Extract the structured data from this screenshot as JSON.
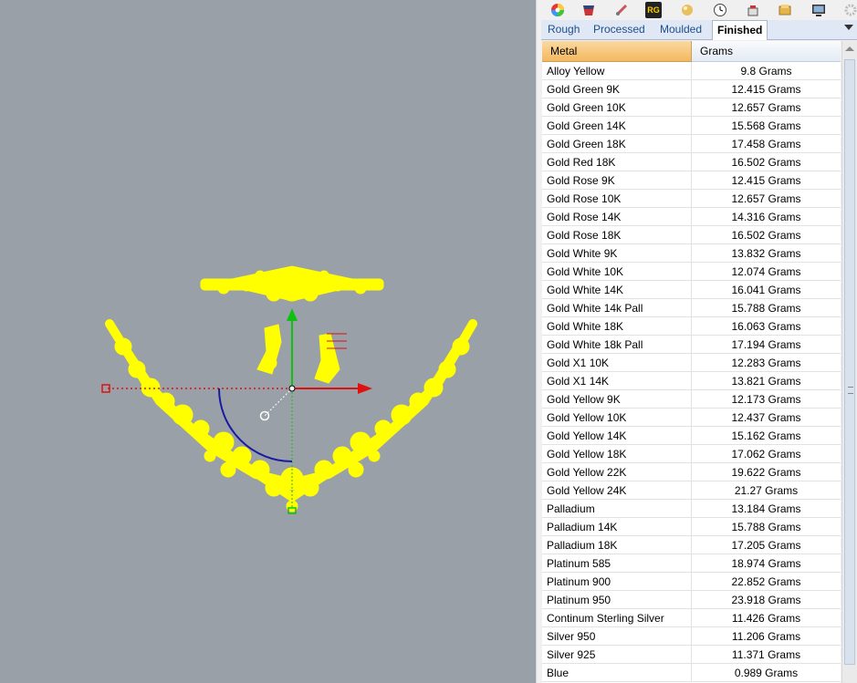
{
  "toolbar": {
    "icons": [
      "color-wheel-icon",
      "paint-bucket-icon",
      "brush-icon",
      "rg-logo-icon",
      "gem-icon",
      "clock-icon",
      "scale-icon",
      "gold-bar-icon",
      "monitor-icon",
      "settings-icon"
    ],
    "rg_label": "RG"
  },
  "tabs": [
    "Rough",
    "Processed",
    "Moulded",
    "Finished"
  ],
  "active_tab": "Finished",
  "table": {
    "headers": [
      "Metal",
      "Grams"
    ],
    "rows": [
      [
        "Alloy Yellow",
        "9.8 Grams"
      ],
      [
        "Gold Green 9K",
        "12.415 Grams"
      ],
      [
        "Gold Green 10K",
        "12.657 Grams"
      ],
      [
        "Gold Green 14K",
        "15.568 Grams"
      ],
      [
        "Gold Green 18K",
        "17.458 Grams"
      ],
      [
        "Gold Red 18K",
        "16.502 Grams"
      ],
      [
        "Gold Rose 9K",
        "12.415 Grams"
      ],
      [
        "Gold Rose 10K",
        "12.657 Grams"
      ],
      [
        "Gold Rose 14K",
        "14.316 Grams"
      ],
      [
        "Gold Rose 18K",
        "16.502 Grams"
      ],
      [
        "Gold White 9K",
        "13.832 Grams"
      ],
      [
        "Gold White 10K",
        "12.074 Grams"
      ],
      [
        "Gold White 14K",
        "16.041 Grams"
      ],
      [
        "Gold White 14k Pall",
        "15.788 Grams"
      ],
      [
        "Gold White 18K",
        "16.063 Grams"
      ],
      [
        "Gold White 18k Pall",
        "17.194 Grams"
      ],
      [
        "Gold X1 10K",
        "12.283 Grams"
      ],
      [
        "Gold X1 14K",
        "13.821 Grams"
      ],
      [
        "Gold Yellow 9K",
        "12.173 Grams"
      ],
      [
        "Gold Yellow 10K",
        "12.437 Grams"
      ],
      [
        "Gold Yellow 14K",
        "15.162 Grams"
      ],
      [
        "Gold Yellow 18K",
        "17.062 Grams"
      ],
      [
        "Gold Yellow 22K",
        "19.622 Grams"
      ],
      [
        "Gold Yellow 24K",
        "21.27 Grams"
      ],
      [
        "Palladium",
        "13.184 Grams"
      ],
      [
        "Palladium 14K",
        "15.788 Grams"
      ],
      [
        "Palladium 18K",
        "17.205 Grams"
      ],
      [
        "Platinum 585",
        "18.974 Grams"
      ],
      [
        "Platinum 900",
        "22.852 Grams"
      ],
      [
        "Platinum 950",
        "23.918 Grams"
      ],
      [
        "Continum Sterling Silver",
        "11.426 Grams"
      ],
      [
        "Silver 950",
        "11.206 Grams"
      ],
      [
        "Silver 925",
        "11.371 Grams"
      ],
      [
        "Blue",
        "0.989 Grams"
      ]
    ]
  },
  "colors": {
    "viewport_bg": "#99a0a7",
    "model": "#ffff00",
    "x_axis": "#e01010",
    "y_axis": "#10c010",
    "rotate_arc": "#1a1aa0",
    "header_active": "#f3b860"
  }
}
